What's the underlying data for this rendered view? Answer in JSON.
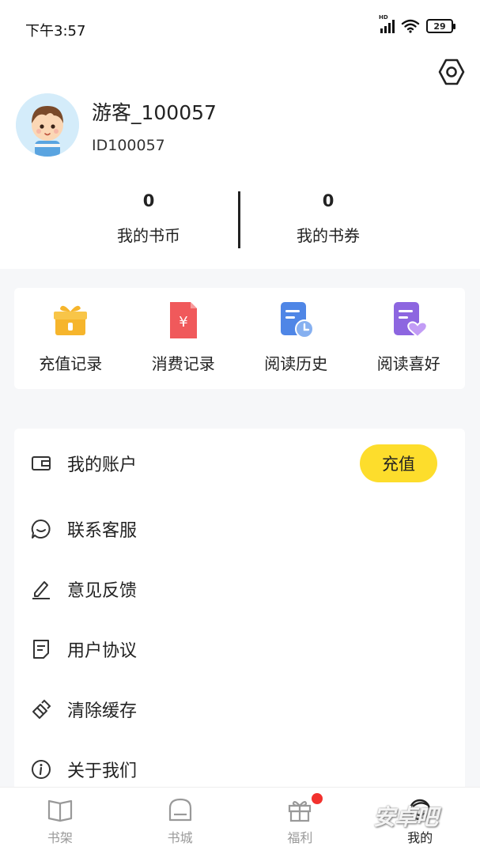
{
  "status_bar": {
    "time": "下午3:57",
    "battery": "29"
  },
  "profile": {
    "username": "游客_100057",
    "user_id": "ID100057",
    "stats": [
      {
        "value": "0",
        "label": "我的书币"
      },
      {
        "value": "0",
        "label": "我的书券"
      }
    ]
  },
  "quick_actions": [
    {
      "label": "充值记录",
      "icon": "gift-box-icon"
    },
    {
      "label": "消费记录",
      "icon": "yuan-receipt-icon"
    },
    {
      "label": "阅读历史",
      "icon": "history-doc-icon"
    },
    {
      "label": "阅读喜好",
      "icon": "heart-doc-icon"
    }
  ],
  "menu": {
    "items": [
      {
        "label": "我的账户",
        "icon": "wallet-icon"
      },
      {
        "label": "联系客服",
        "icon": "chat-bubble-icon"
      },
      {
        "label": "意见反馈",
        "icon": "pencil-icon"
      },
      {
        "label": "用户协议",
        "icon": "document-icon"
      },
      {
        "label": "清除缓存",
        "icon": "eraser-icon"
      },
      {
        "label": "关于我们",
        "icon": "info-icon"
      }
    ],
    "recharge_label": "充值"
  },
  "tabbar": {
    "tabs": [
      {
        "label": "书架",
        "icon": "book-icon"
      },
      {
        "label": "书城",
        "icon": "store-icon"
      },
      {
        "label": "福利",
        "icon": "gift-icon"
      },
      {
        "label": "我的",
        "icon": "user-face-icon"
      }
    ],
    "active": "我的"
  },
  "watermark": "安卓吧",
  "colors": {
    "accent": "#fddd2c",
    "badge": "#f2312d",
    "background": "#f6f7f9"
  }
}
